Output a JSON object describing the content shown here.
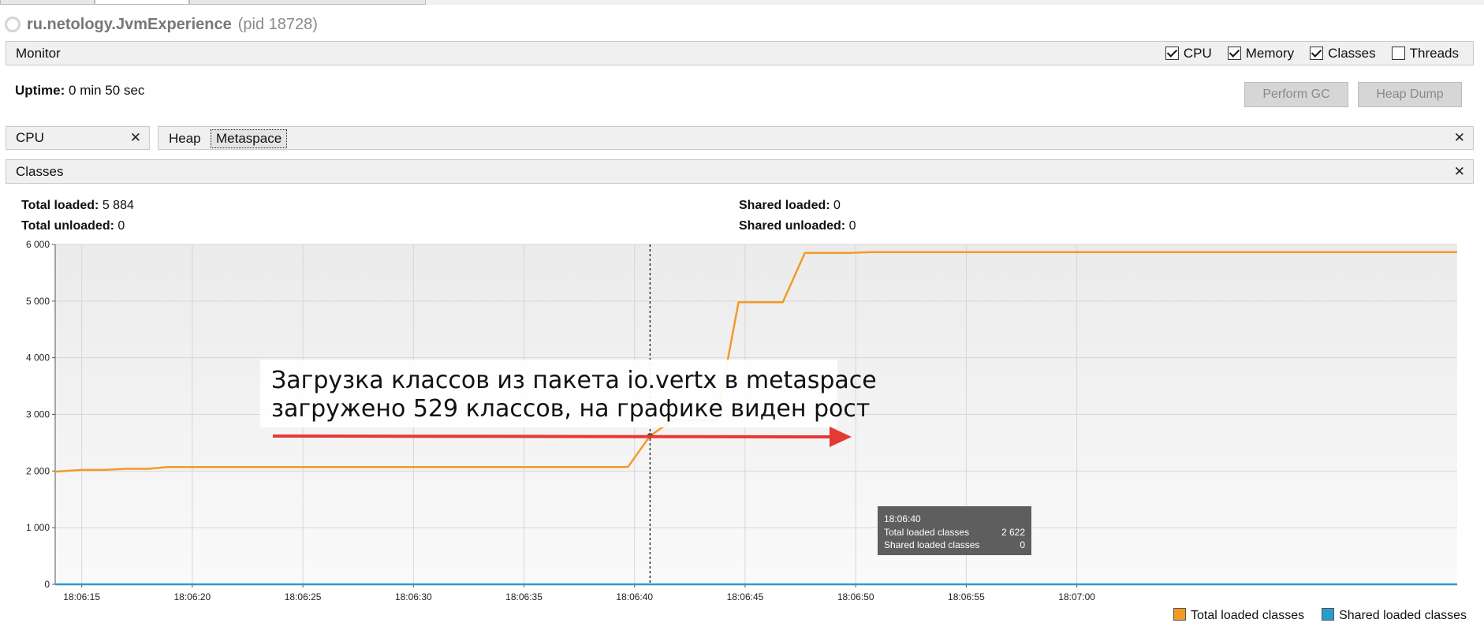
{
  "window": {
    "app_name": "ru.netology.JvmExperience",
    "pid": "(pid 18728)"
  },
  "monitor": {
    "title": "Monitor",
    "checkboxes": [
      {
        "label": "CPU",
        "checked": true
      },
      {
        "label": "Memory",
        "checked": true
      },
      {
        "label": "Classes",
        "checked": true
      },
      {
        "label": "Threads",
        "checked": false
      }
    ],
    "uptime_label": "Uptime:",
    "uptime_value": "0 min 50 sec",
    "perform_gc": "Perform GC",
    "heap_dump": "Heap Dump"
  },
  "panels": {
    "cpu_tab": "CPU",
    "memory_tabs": [
      "Heap",
      "Metaspace"
    ],
    "close_glyph": "✕"
  },
  "classes": {
    "title": "Classes",
    "total_loaded_label": "Total loaded:",
    "total_loaded_value": "5 884",
    "total_unloaded_label": "Total unloaded:",
    "total_unloaded_value": "0",
    "shared_loaded_label": "Shared loaded:",
    "shared_loaded_value": "0",
    "shared_unloaded_label": "Shared unloaded:",
    "shared_unloaded_value": "0"
  },
  "annotation": {
    "line1": "Загрузка классов из пакета io.vertx в metaspace",
    "line2": "загружено 529 классов, на графике виден рост",
    "color": "#e53935"
  },
  "tooltip": {
    "time": "18:06:40",
    "row1_label": "Total loaded classes",
    "row1_value": "2 622",
    "row2_label": "Shared loaded classes",
    "row2_value": "0"
  },
  "chart_data": {
    "type": "line",
    "title": "Classes",
    "ylim": [
      0,
      6000
    ],
    "y_ticks": [
      0,
      1000,
      2000,
      3000,
      4000,
      5000,
      6000
    ],
    "y_tick_labels": [
      "0",
      "1 000",
      "2 000",
      "3 000",
      "4 000",
      "5 000",
      "6 000"
    ],
    "x_range_seconds": [
      13.8,
      77.2
    ],
    "x_ticks": [
      15,
      20,
      25,
      30,
      35,
      40,
      45,
      50,
      55,
      60
    ],
    "x_tick_labels": [
      "18:06:15",
      "18:06:20",
      "18:06:25",
      "18:06:30",
      "18:06:35",
      "18:06:40",
      "18:06:45",
      "18:06:50",
      "18:06:55",
      "18:07:00"
    ],
    "cursor_x": 40.7,
    "grid": true,
    "legend_position": "bottom-right",
    "series": [
      {
        "name": "Total loaded classes",
        "color": "#f39a26",
        "points": [
          [
            13.8,
            1990
          ],
          [
            15.0,
            2020
          ],
          [
            16.0,
            2020
          ],
          [
            17.0,
            2040
          ],
          [
            18.0,
            2040
          ],
          [
            18.9,
            2070
          ],
          [
            20.0,
            2070
          ],
          [
            25.0,
            2070
          ],
          [
            30.0,
            2070
          ],
          [
            35.0,
            2070
          ],
          [
            39.7,
            2070
          ],
          [
            40.7,
            2622
          ],
          [
            41.7,
            2890
          ],
          [
            43.7,
            2890
          ],
          [
            44.7,
            4980
          ],
          [
            46.7,
            4980
          ],
          [
            47.7,
            5850
          ],
          [
            49.7,
            5850
          ],
          [
            50.7,
            5865
          ],
          [
            55.0,
            5865
          ],
          [
            60.0,
            5865
          ],
          [
            77.2,
            5865
          ]
        ]
      },
      {
        "name": "Shared loaded classes",
        "color": "#2b9ccf",
        "points": [
          [
            13.8,
            0
          ],
          [
            77.2,
            0
          ]
        ]
      }
    ]
  }
}
